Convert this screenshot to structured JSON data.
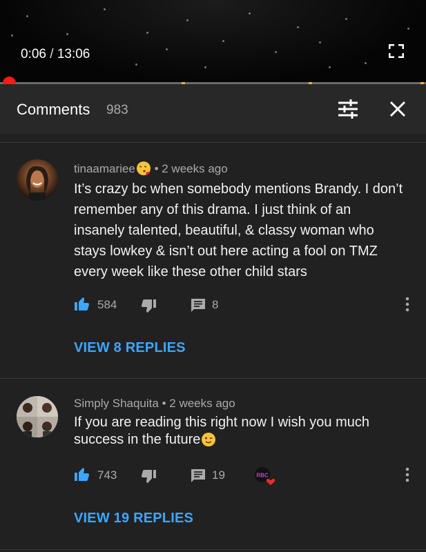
{
  "player": {
    "current_time": "0:06",
    "separator": "/",
    "duration": "13:06",
    "fullscreen_icon": "fullscreen-icon",
    "progress_fraction": 0.0077
  },
  "comments_header": {
    "title": "Comments",
    "count": "983",
    "filter_icon": "sort-icon",
    "close_icon": "close-icon"
  },
  "comments": [
    {
      "author": "tinaamariee",
      "time": "2 weeks ago",
      "text": "It’s crazy bc when somebody mentions Brandy. I don’t remember any of this drama. I just think of an insanely talented, beautiful, & classy woman who stays lowkey & isn’t out here acting a fool on TMZ every week like these other child stars",
      "likes": "584",
      "replies_count": "8",
      "view_replies": "VIEW 8 REPLIES"
    },
    {
      "author": "Simply Shaquita",
      "time": "2 weeks ago",
      "text": "If you are reading this right now I wish you much success in the future",
      "likes": "743",
      "replies_count": "19",
      "view_replies": "VIEW 19 REPLIES",
      "creator_heart_badge": "RBC"
    }
  ],
  "colors": {
    "background": "#212121",
    "header": "#282828",
    "accent_blue": "#3ea6ff",
    "progress_red": "#ff1a1a",
    "ad_marker": "#f2b52d"
  }
}
